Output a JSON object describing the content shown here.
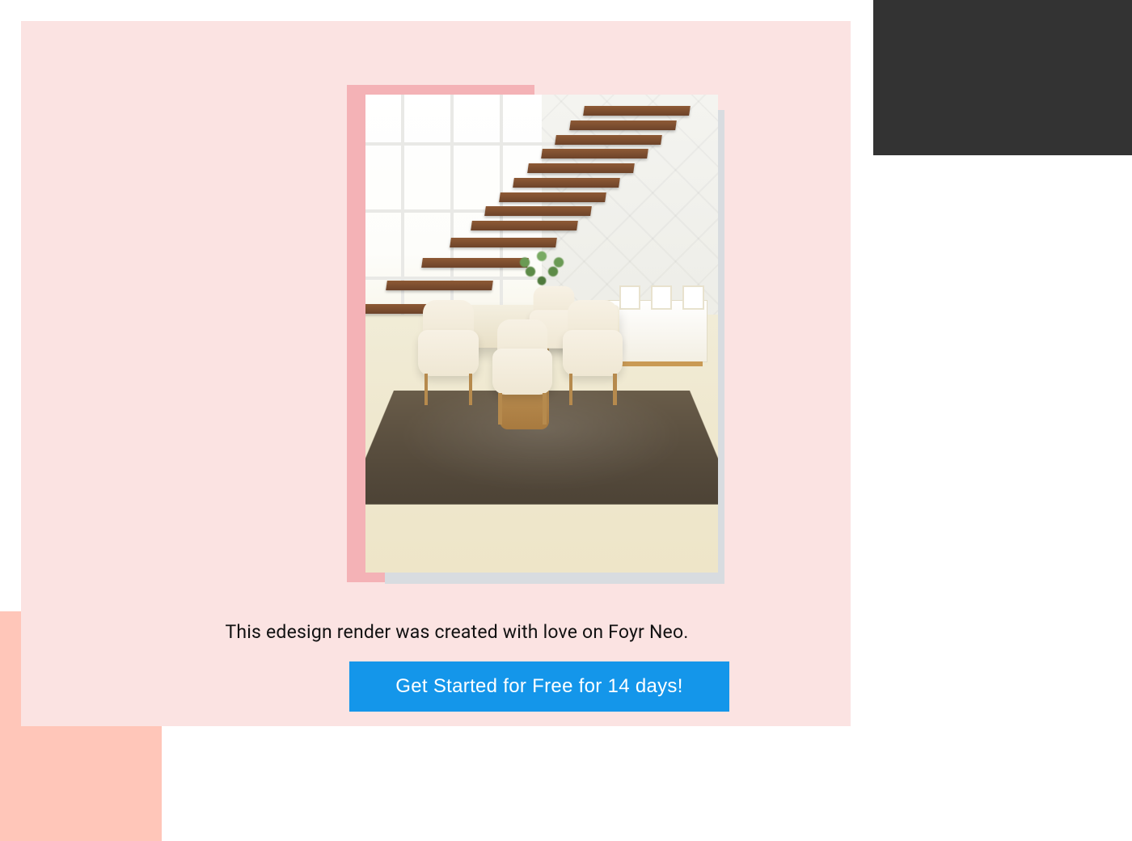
{
  "colors": {
    "card_bg": "#fbe3e2",
    "accent_pink": "#f4b2b6",
    "accent_peach": "#ffc6b9",
    "accent_dark": "#333333",
    "cta_bg": "#1496ea",
    "cta_text": "#ffffff",
    "text": "#111111"
  },
  "hero_image": {
    "description": "Interior render: dining area with cream upholstered chairs around a light wood table on a dark shag rug, fern centerpiece, floating wooden staircase over a tall window, white 3D geometric accent wall, low sideboard with framed photos.",
    "icon_name": "interior-render-image"
  },
  "caption": "This edesign render was created with love on Foyr Neo.",
  "cta_label": "Get Started for Free for 14 days!"
}
